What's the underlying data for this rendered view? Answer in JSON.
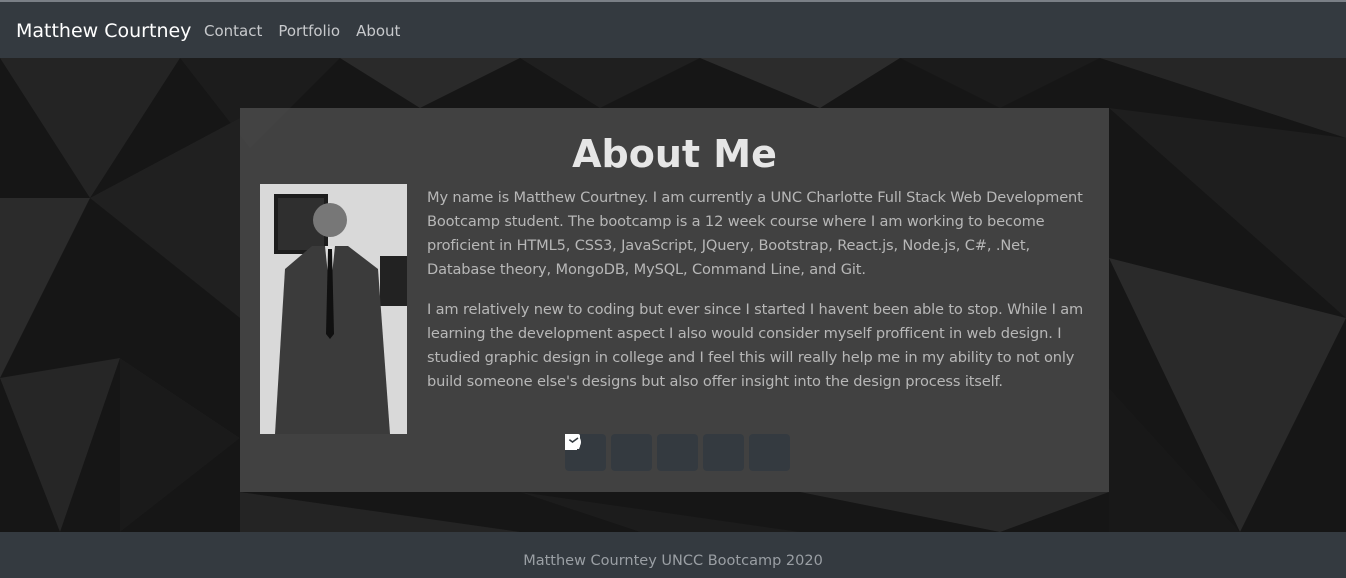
{
  "navbar": {
    "brand": "Matthew Courtney",
    "links": [
      {
        "label": "Contact"
      },
      {
        "label": "Portfolio"
      },
      {
        "label": "About"
      }
    ]
  },
  "about": {
    "title": "About Me",
    "photo_icon": "profile-photo",
    "paragraphs": [
      "My name is Matthew Courtney. I am currently a UNC Charlotte Full Stack Web Development Bootcamp student. The bootcamp is a 12 week course where I am working to become proficient in HTML5, CSS3, JavaScript, JQuery, Bootstrap, React.js, Node.js, C#, .Net, Database theory, MongoDB, MySQL, Command Line, and Git.",
      "I am relatively new to coding but ever since I started I havent been able to stop. While I am learning the development aspect I also would consider myself profficent in web design. I studied graphic design in college and I feel this will really help me in my ability to not only build someone else's designs but also offer insight into the design process itself."
    ],
    "social_icons": [
      "github-icon",
      "linkedin-icon",
      "resume-file-icon",
      "email-icon",
      "phone-icon"
    ]
  },
  "footer": {
    "text": "Matthew Courntey UNCC Bootcamp 2020"
  },
  "colors": {
    "navbar": "#343a40",
    "panel": "#5c5c5c",
    "text_light": "#b7b7b7"
  }
}
